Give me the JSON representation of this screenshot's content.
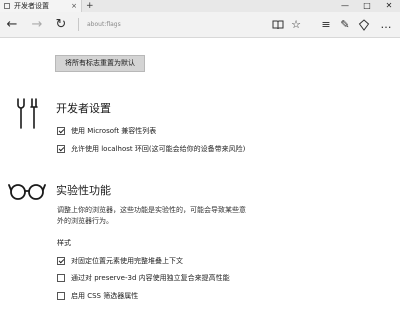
{
  "tab": {
    "title": "开发者设置",
    "close": "×"
  },
  "titlebar": {
    "new_tab": "+",
    "minimize": "—",
    "maximize": "□",
    "close": "✕"
  },
  "nav": {
    "back": "←",
    "forward": "→",
    "refresh": "↻",
    "address": "about:flags",
    "icons": [
      "reading-view-icon",
      "favorites-star-icon",
      "hub-icon",
      "notes-icon",
      "share-icon",
      "more-icon"
    ]
  },
  "toolbar_glyphs": {
    "reading": "📖",
    "star": "☆",
    "hub": "≡",
    "notes": "✎",
    "share": "♲",
    "more": "…"
  },
  "reset_button": "将所有标志重置为默认",
  "developer": {
    "heading": "开发者设置",
    "options": [
      {
        "label": "使用 Microsoft 兼容性列表",
        "checked": true
      },
      {
        "label": "允许使用 localhost 环回(这可能会给你的设备带来风险)",
        "checked": true
      }
    ]
  },
  "experimental": {
    "heading": "实验性功能",
    "description": "调整上你的浏览器，这些功能是实验性的，可能会导致某些意外的浏览器行为。",
    "styles_heading": "样式",
    "options": [
      {
        "label": "对固定位置元素使用完整堆叠上下文",
        "checked": true
      },
      {
        "label": "通过对 preserve-3d 内容使用独立复合来提高性能",
        "checked": false
      },
      {
        "label": "启用 CSS 筛选器属性",
        "checked": false
      }
    ]
  }
}
